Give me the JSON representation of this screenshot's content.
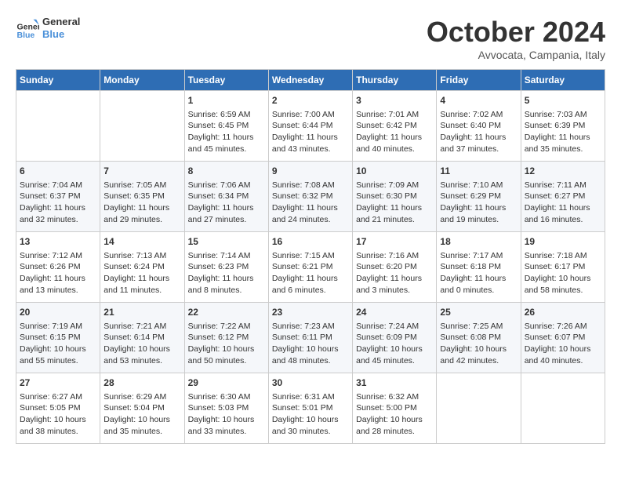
{
  "header": {
    "logo_line1": "General",
    "logo_line2": "Blue",
    "month": "October 2024",
    "location": "Avvocata, Campania, Italy"
  },
  "days_of_week": [
    "Sunday",
    "Monday",
    "Tuesday",
    "Wednesday",
    "Thursday",
    "Friday",
    "Saturday"
  ],
  "weeks": [
    [
      {
        "day": "",
        "content": ""
      },
      {
        "day": "",
        "content": ""
      },
      {
        "day": "1",
        "content": "Sunrise: 6:59 AM\nSunset: 6:45 PM\nDaylight: 11 hours\nand 45 minutes."
      },
      {
        "day": "2",
        "content": "Sunrise: 7:00 AM\nSunset: 6:44 PM\nDaylight: 11 hours\nand 43 minutes."
      },
      {
        "day": "3",
        "content": "Sunrise: 7:01 AM\nSunset: 6:42 PM\nDaylight: 11 hours\nand 40 minutes."
      },
      {
        "day": "4",
        "content": "Sunrise: 7:02 AM\nSunset: 6:40 PM\nDaylight: 11 hours\nand 37 minutes."
      },
      {
        "day": "5",
        "content": "Sunrise: 7:03 AM\nSunset: 6:39 PM\nDaylight: 11 hours\nand 35 minutes."
      }
    ],
    [
      {
        "day": "6",
        "content": "Sunrise: 7:04 AM\nSunset: 6:37 PM\nDaylight: 11 hours\nand 32 minutes."
      },
      {
        "day": "7",
        "content": "Sunrise: 7:05 AM\nSunset: 6:35 PM\nDaylight: 11 hours\nand 29 minutes."
      },
      {
        "day": "8",
        "content": "Sunrise: 7:06 AM\nSunset: 6:34 PM\nDaylight: 11 hours\nand 27 minutes."
      },
      {
        "day": "9",
        "content": "Sunrise: 7:08 AM\nSunset: 6:32 PM\nDaylight: 11 hours\nand 24 minutes."
      },
      {
        "day": "10",
        "content": "Sunrise: 7:09 AM\nSunset: 6:30 PM\nDaylight: 11 hours\nand 21 minutes."
      },
      {
        "day": "11",
        "content": "Sunrise: 7:10 AM\nSunset: 6:29 PM\nDaylight: 11 hours\nand 19 minutes."
      },
      {
        "day": "12",
        "content": "Sunrise: 7:11 AM\nSunset: 6:27 PM\nDaylight: 11 hours\nand 16 minutes."
      }
    ],
    [
      {
        "day": "13",
        "content": "Sunrise: 7:12 AM\nSunset: 6:26 PM\nDaylight: 11 hours\nand 13 minutes."
      },
      {
        "day": "14",
        "content": "Sunrise: 7:13 AM\nSunset: 6:24 PM\nDaylight: 11 hours\nand 11 minutes."
      },
      {
        "day": "15",
        "content": "Sunrise: 7:14 AM\nSunset: 6:23 PM\nDaylight: 11 hours\nand 8 minutes."
      },
      {
        "day": "16",
        "content": "Sunrise: 7:15 AM\nSunset: 6:21 PM\nDaylight: 11 hours\nand 6 minutes."
      },
      {
        "day": "17",
        "content": "Sunrise: 7:16 AM\nSunset: 6:20 PM\nDaylight: 11 hours\nand 3 minutes."
      },
      {
        "day": "18",
        "content": "Sunrise: 7:17 AM\nSunset: 6:18 PM\nDaylight: 11 hours\nand 0 minutes."
      },
      {
        "day": "19",
        "content": "Sunrise: 7:18 AM\nSunset: 6:17 PM\nDaylight: 10 hours\nand 58 minutes."
      }
    ],
    [
      {
        "day": "20",
        "content": "Sunrise: 7:19 AM\nSunset: 6:15 PM\nDaylight: 10 hours\nand 55 minutes."
      },
      {
        "day": "21",
        "content": "Sunrise: 7:21 AM\nSunset: 6:14 PM\nDaylight: 10 hours\nand 53 minutes."
      },
      {
        "day": "22",
        "content": "Sunrise: 7:22 AM\nSunset: 6:12 PM\nDaylight: 10 hours\nand 50 minutes."
      },
      {
        "day": "23",
        "content": "Sunrise: 7:23 AM\nSunset: 6:11 PM\nDaylight: 10 hours\nand 48 minutes."
      },
      {
        "day": "24",
        "content": "Sunrise: 7:24 AM\nSunset: 6:09 PM\nDaylight: 10 hours\nand 45 minutes."
      },
      {
        "day": "25",
        "content": "Sunrise: 7:25 AM\nSunset: 6:08 PM\nDaylight: 10 hours\nand 42 minutes."
      },
      {
        "day": "26",
        "content": "Sunrise: 7:26 AM\nSunset: 6:07 PM\nDaylight: 10 hours\nand 40 minutes."
      }
    ],
    [
      {
        "day": "27",
        "content": "Sunrise: 6:27 AM\nSunset: 5:05 PM\nDaylight: 10 hours\nand 38 minutes."
      },
      {
        "day": "28",
        "content": "Sunrise: 6:29 AM\nSunset: 5:04 PM\nDaylight: 10 hours\nand 35 minutes."
      },
      {
        "day": "29",
        "content": "Sunrise: 6:30 AM\nSunset: 5:03 PM\nDaylight: 10 hours\nand 33 minutes."
      },
      {
        "day": "30",
        "content": "Sunrise: 6:31 AM\nSunset: 5:01 PM\nDaylight: 10 hours\nand 30 minutes."
      },
      {
        "day": "31",
        "content": "Sunrise: 6:32 AM\nSunset: 5:00 PM\nDaylight: 10 hours\nand 28 minutes."
      },
      {
        "day": "",
        "content": ""
      },
      {
        "day": "",
        "content": ""
      }
    ]
  ]
}
